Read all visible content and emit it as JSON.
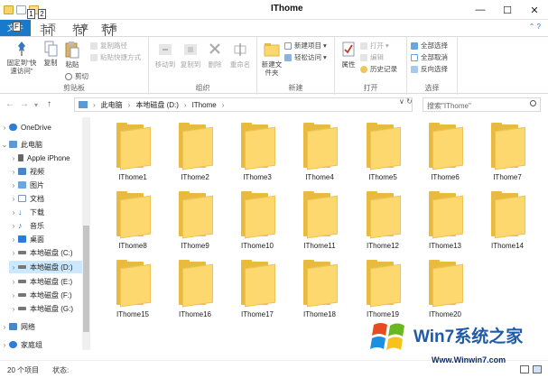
{
  "window": {
    "title": "IThome",
    "keytips": [
      "1",
      "2",
      "F",
      "H",
      "S",
      "V"
    ]
  },
  "ribbon_tabs": {
    "file": "文件",
    "home": "主页",
    "share": "共享",
    "view": "查看"
  },
  "ribbon": {
    "clipboard": {
      "label": "剪贴板",
      "pin": "固定到\"快速访问\"",
      "copy": "复制",
      "paste": "粘贴",
      "copy_path": "复制路径",
      "paste_shortcut": "粘贴快捷方式",
      "cut": "剪切"
    },
    "organize": {
      "label": "组织",
      "move_to": "移动到",
      "copy_to": "复制到",
      "delete": "删除",
      "rename": "重命名"
    },
    "new": {
      "label": "新建",
      "new_folder": "新建文件夹",
      "new_item": "新建项目",
      "easy_access": "轻松访问"
    },
    "open": {
      "label": "打开",
      "properties": "属性",
      "open": "打开",
      "edit": "编辑",
      "history": "历史记录"
    },
    "select": {
      "label": "选择",
      "select_all": "全部选择",
      "select_none": "全部取消",
      "invert": "反向选择"
    }
  },
  "address": {
    "parts": [
      "此电脑",
      "本地磁盘 (D:)",
      "IThome"
    ],
    "search_placeholder": "搜索\"IThome\""
  },
  "nav": {
    "items": [
      {
        "label": "OneDrive"
      },
      {
        "label": "此电脑"
      },
      {
        "label": "Apple iPhone"
      },
      {
        "label": "视频"
      },
      {
        "label": "图片"
      },
      {
        "label": "文档"
      },
      {
        "label": "下载"
      },
      {
        "label": "音乐"
      },
      {
        "label": "桌面"
      },
      {
        "label": "本地磁盘 (C:)"
      },
      {
        "label": "本地磁盘 (D:)"
      },
      {
        "label": "本地磁盘 (E:)"
      },
      {
        "label": "本地磁盘 (F:)"
      },
      {
        "label": "本地磁盘 (G:)"
      },
      {
        "label": "网络"
      },
      {
        "label": "家庭组"
      }
    ]
  },
  "folders": [
    "IThome1",
    "IThome2",
    "IThome3",
    "IThome4",
    "IThome5",
    "IThome6",
    "IThome7",
    "IThome8",
    "IThome9",
    "IThome10",
    "IThome11",
    "IThome12",
    "IThome13",
    "IThome14",
    "IThome15",
    "IThome16",
    "IThome17",
    "IThome18",
    "IThome19",
    "IThome20"
  ],
  "status": {
    "count": "20 个项目",
    "state": "状态:"
  },
  "watermark": {
    "title": "Win7系统之家",
    "url": "Www.Winwin7.com"
  },
  "colors": {
    "file_tab": "#1979ca",
    "folder": "#fcd86f",
    "selection": "#cce8ff"
  }
}
